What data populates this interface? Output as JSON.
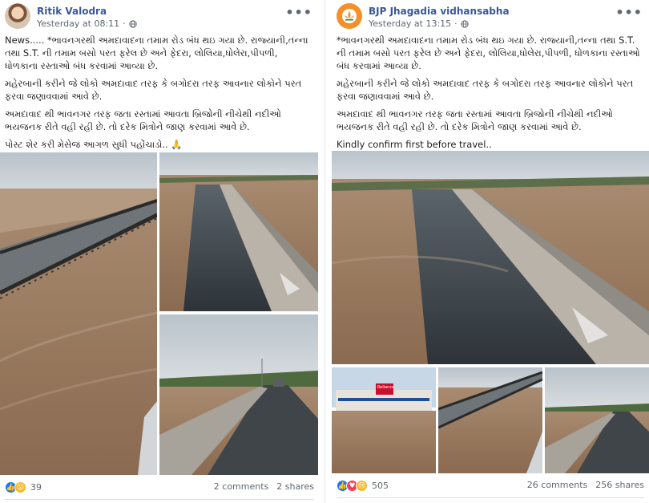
{
  "left_post": {
    "author": "Ritik Valodra",
    "time": "Yesterday at 08:11",
    "globe_icon": "globe-icon",
    "more_label": "•••",
    "paragraphs": [
      "News..... *ભાવનગરથી અમદાવાદના તમામ રોડ બંધ થઇ ગયા છે. રાજ્યાની,તન્ના તથા S.T. ની તમામ બસો પરત ફરેલ છે અને ફેદરા, લોલિયા,ધોલેરા,પીપળી, ધોળકાના રસ્તાઓ બંધ કરવામાં આવ્યા છે.",
      "મહેરબાની કરીને જે લોકો અમદાવાદ તરફ કે બગોદરા તરફ આવનાર લોકોને પરત ફરવા જણાવવામાં આવે છે.",
      "અમદાવાદ થી ભાવનગર તરફ જતા રસ્તામાં આવતા બ્રિજોની નીચેથી નદીઓ ભયજનક રીતે વહી રહી છે. તો દરેક મિત્રોને જાણ કરવામાં આવે છે.",
      "પોસ્ટ શેર કરી મેસેજ આગળ સુધી પહોંચાડો.. 🙏"
    ],
    "reaction_count": "39",
    "comments": "2 comments",
    "shares": "2 shares"
  },
  "right_post": {
    "author": "BJP Jhagadia vidhansabha",
    "time": "Yesterday at 13:15",
    "globe_icon": "globe-icon",
    "more_label": "•••",
    "paragraphs": [
      "*ભાવનગરથી અમદાવાદના તમામ રોડ બંધ થઇ ગયા છે. રાજ્યાની,તન્ના તથા S.T. ની તમામ બસો પરત ફરેલ છે અને ફેદરા, લોલિયા,ધોલેરા,પીપળી, ધોળકાના રસ્તાઓ બંધ કરવામાં આવ્યા છે.",
      "મહેરબાની કરીને જે લોકો અમદાવાદ તરફ કે બગોદરા તરફ આવનાર લોકોને પરત ફરવા જણાવવામાં આવે છે.",
      "અમદાવાદ થી ભાવનગર તરફ જતા રસ્તામાં આવતા બ્રિજોની નીચેથી નદીઓ ભયજનક રીતે વહી રહી છે. તો દરેક મિત્રોને જાણ કરવામાં આવે છે.",
      "Kindly confirm first before travel.."
    ],
    "store_sign": "Reliance",
    "reaction_count": "505",
    "comments": "26 comments",
    "shares": "256 shares"
  },
  "colors": {
    "name_link": "#385898",
    "meta_text": "#616770",
    "like_blue": "#1877f2",
    "love_red": "#f33e58",
    "wow_yellow": "#f7b928",
    "flood_water": "#9a7a5e",
    "bjp_orange": "#f4902a"
  }
}
